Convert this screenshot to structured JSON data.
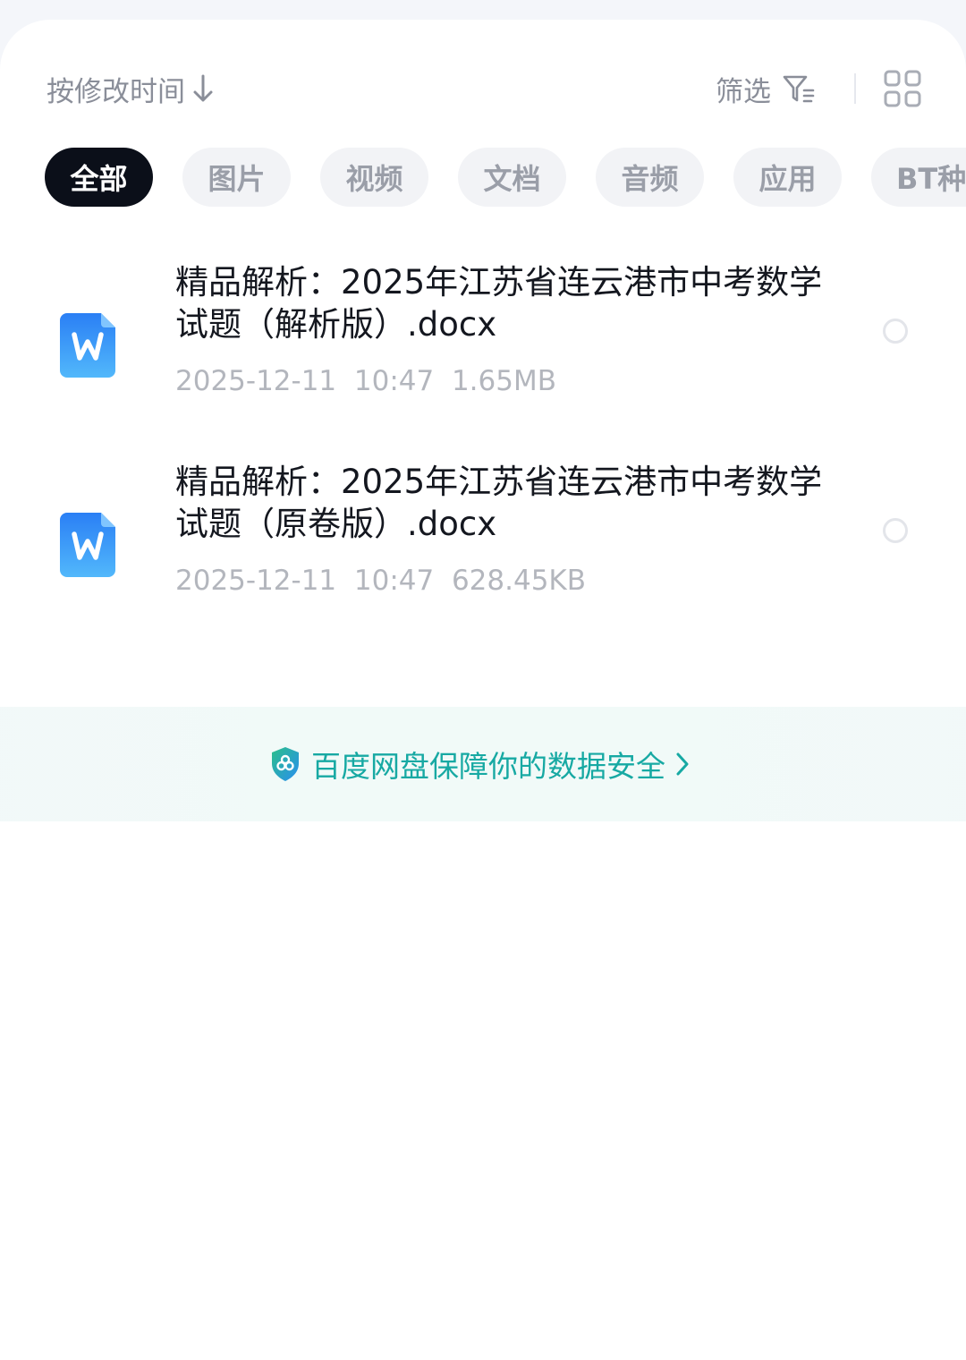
{
  "toolbar": {
    "sort_label": "按修改时间",
    "filter_label": "筛选"
  },
  "tabs": [
    {
      "label": "全部",
      "active": true
    },
    {
      "label": "图片",
      "active": false
    },
    {
      "label": "视频",
      "active": false
    },
    {
      "label": "文档",
      "active": false
    },
    {
      "label": "音频",
      "active": false
    },
    {
      "label": "应用",
      "active": false
    },
    {
      "label": "BT种",
      "active": false
    }
  ],
  "files": [
    {
      "name": "精品解析：2025年江苏省连云港市中考数学试题（解析版）.docx",
      "date": "2025-12-11",
      "time": "10:47",
      "size": "1.65MB",
      "icon": "word-doc-icon"
    },
    {
      "name": "精品解析：2025年江苏省连云港市中考数学试题（原卷版）.docx",
      "date": "2025-12-11",
      "time": "10:47",
      "size": "628.45KB",
      "icon": "word-doc-icon"
    }
  ],
  "banner": {
    "text": "百度网盘保障你的数据安全"
  },
  "colors": {
    "accent_teal": "#17a9a3",
    "word_blue": "#2f86f6",
    "active_tab": "#0b0f19"
  }
}
